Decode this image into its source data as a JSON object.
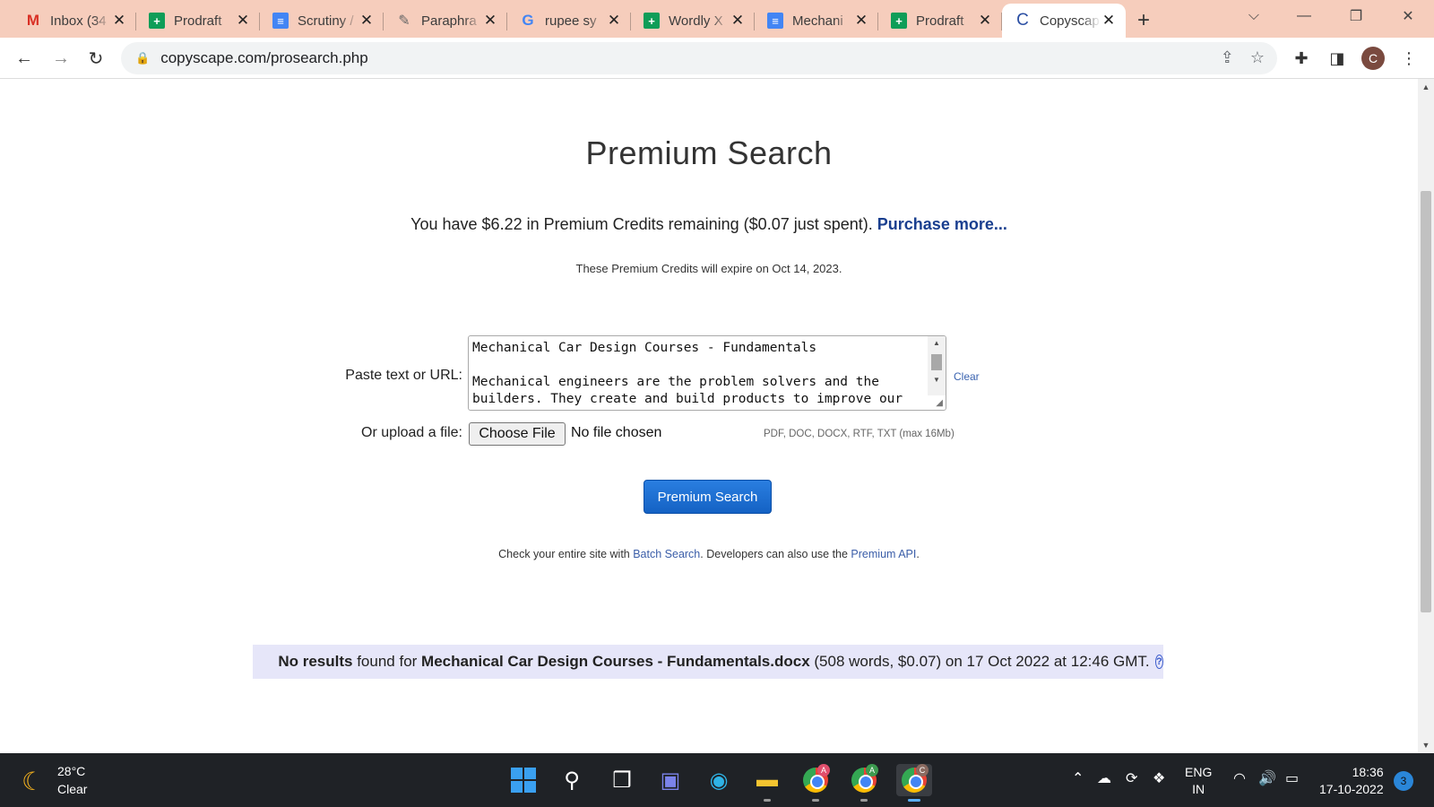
{
  "tabs": [
    {
      "title": "Inbox (34",
      "icon": "gmail-icon",
      "glyph": "M"
    },
    {
      "title": "Prodraft",
      "icon": "sheets-icon",
      "glyph": "+"
    },
    {
      "title": "Scrutiny /",
      "icon": "docs-icon",
      "glyph": "≡"
    },
    {
      "title": "Paraphra",
      "icon": "feather-icon",
      "glyph": "✎"
    },
    {
      "title": "rupee sy",
      "icon": "google-icon",
      "glyph": "G"
    },
    {
      "title": "Wordly X",
      "icon": "sheets-icon",
      "glyph": "+"
    },
    {
      "title": "Mechani",
      "icon": "docs-icon",
      "glyph": "≡"
    },
    {
      "title": "Prodraft",
      "icon": "sheets-icon",
      "glyph": "+"
    },
    {
      "title": "Copyscap",
      "icon": "copyscape-icon",
      "glyph": "C",
      "active": true
    }
  ],
  "address": {
    "url": "copyscape.com/prosearch.php"
  },
  "profile": {
    "initial": "C"
  },
  "page": {
    "title": "Premium Search",
    "credits_prefix": "You have $6.22 in Premium Credits remaining ($0.07 just spent).",
    "purchase_link": "Purchase more...",
    "expire_text": "These Premium Credits will expire on Oct 14, 2023.",
    "paste_label": "Paste text or URL:",
    "paste_value": "Mechanical Car Design Courses - Fundamentals\n\nMechanical engineers are the problem solvers and the\nbuilders. They create and build products to improve our",
    "clear_link": "Clear",
    "upload_label": "Or upload a file:",
    "choose_file": "Choose File",
    "no_file": "No file chosen",
    "file_hint": "PDF, DOC, DOCX, RTF, TXT (max 16Mb)",
    "search_button": "Premium Search",
    "batch_prefix": "Check your entire site with ",
    "batch_link": "Batch Search",
    "batch_mid": ". Developers can also use the ",
    "api_link": "Premium API",
    "batch_suffix": ".",
    "result_bold1": "No results",
    "result_mid1": " found for ",
    "result_bold2": "Mechanical Car Design Courses - Fundamentals.docx",
    "result_tail": " (508 words, $0.07) on 17 Oct 2022 at 12:46 GMT.",
    "help_glyph": "?"
  },
  "taskbar": {
    "temperature": "28°C",
    "condition": "Clear",
    "lang1": "ENG",
    "lang2": "IN",
    "time": "18:36",
    "date": "17-10-2022",
    "notifications": "3",
    "chrome_badges": [
      "A",
      "A",
      "C"
    ]
  }
}
